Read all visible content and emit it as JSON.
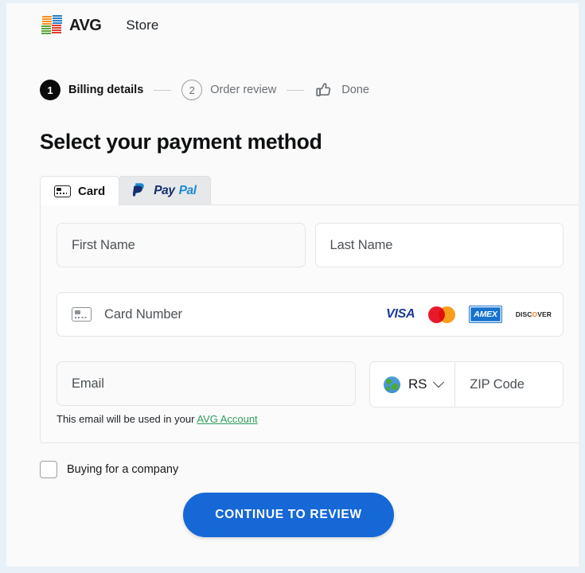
{
  "header": {
    "brand_name": "AVG",
    "brand_logo_icon": "avg-pinwheel-logo",
    "store_label": "Store"
  },
  "stepper": {
    "steps": [
      {
        "badge": "1",
        "label": "Billing details",
        "state": "active",
        "icon": null
      },
      {
        "badge": "2",
        "label": "Order review",
        "state": "upcoming",
        "icon": null
      },
      {
        "badge": "",
        "label": "Done",
        "state": "upcoming",
        "icon": "thumbs-up-icon"
      }
    ]
  },
  "main": {
    "page_title": "Select your payment method",
    "tabs": [
      {
        "label": "Card",
        "icon": "credit-card-icon",
        "active": true
      },
      {
        "label": "PayPal",
        "icon": "paypal-logo",
        "active": false,
        "logo_first": "Pay",
        "logo_second": "Pal"
      }
    ],
    "form": {
      "first_name": {
        "placeholder": "First Name",
        "value": ""
      },
      "last_name": {
        "placeholder": "Last Name",
        "value": ""
      },
      "card_number": {
        "placeholder": "Card Number",
        "value": "",
        "icon": "credit-card-icon"
      },
      "card_brands": [
        {
          "name": "VISA",
          "label": "VISA"
        },
        {
          "name": "Mastercard",
          "label": ""
        },
        {
          "name": "AMEX",
          "label": "AMEX"
        },
        {
          "name": "Discover",
          "label_pre": "DISC",
          "label_dot": "O",
          "label_post": "VER"
        }
      ],
      "email": {
        "placeholder": "Email",
        "value": ""
      },
      "email_note_text": "This email will be used in your ",
      "email_note_link": "AVG Account",
      "country": {
        "code": "RS",
        "icon": "globe-icon",
        "chevron": "chevron-down-icon"
      },
      "zip": {
        "placeholder": "ZIP Code",
        "value": ""
      }
    },
    "company_checkbox": {
      "label": "Buying for a company",
      "checked": false
    },
    "cta_label": "CONTINUE TO REVIEW"
  },
  "colors": {
    "cta_blue": "#1668d6",
    "link_green": "#2e9e5b",
    "page_bg": "#fafafa",
    "frame_blue": "#e8f1f8"
  }
}
